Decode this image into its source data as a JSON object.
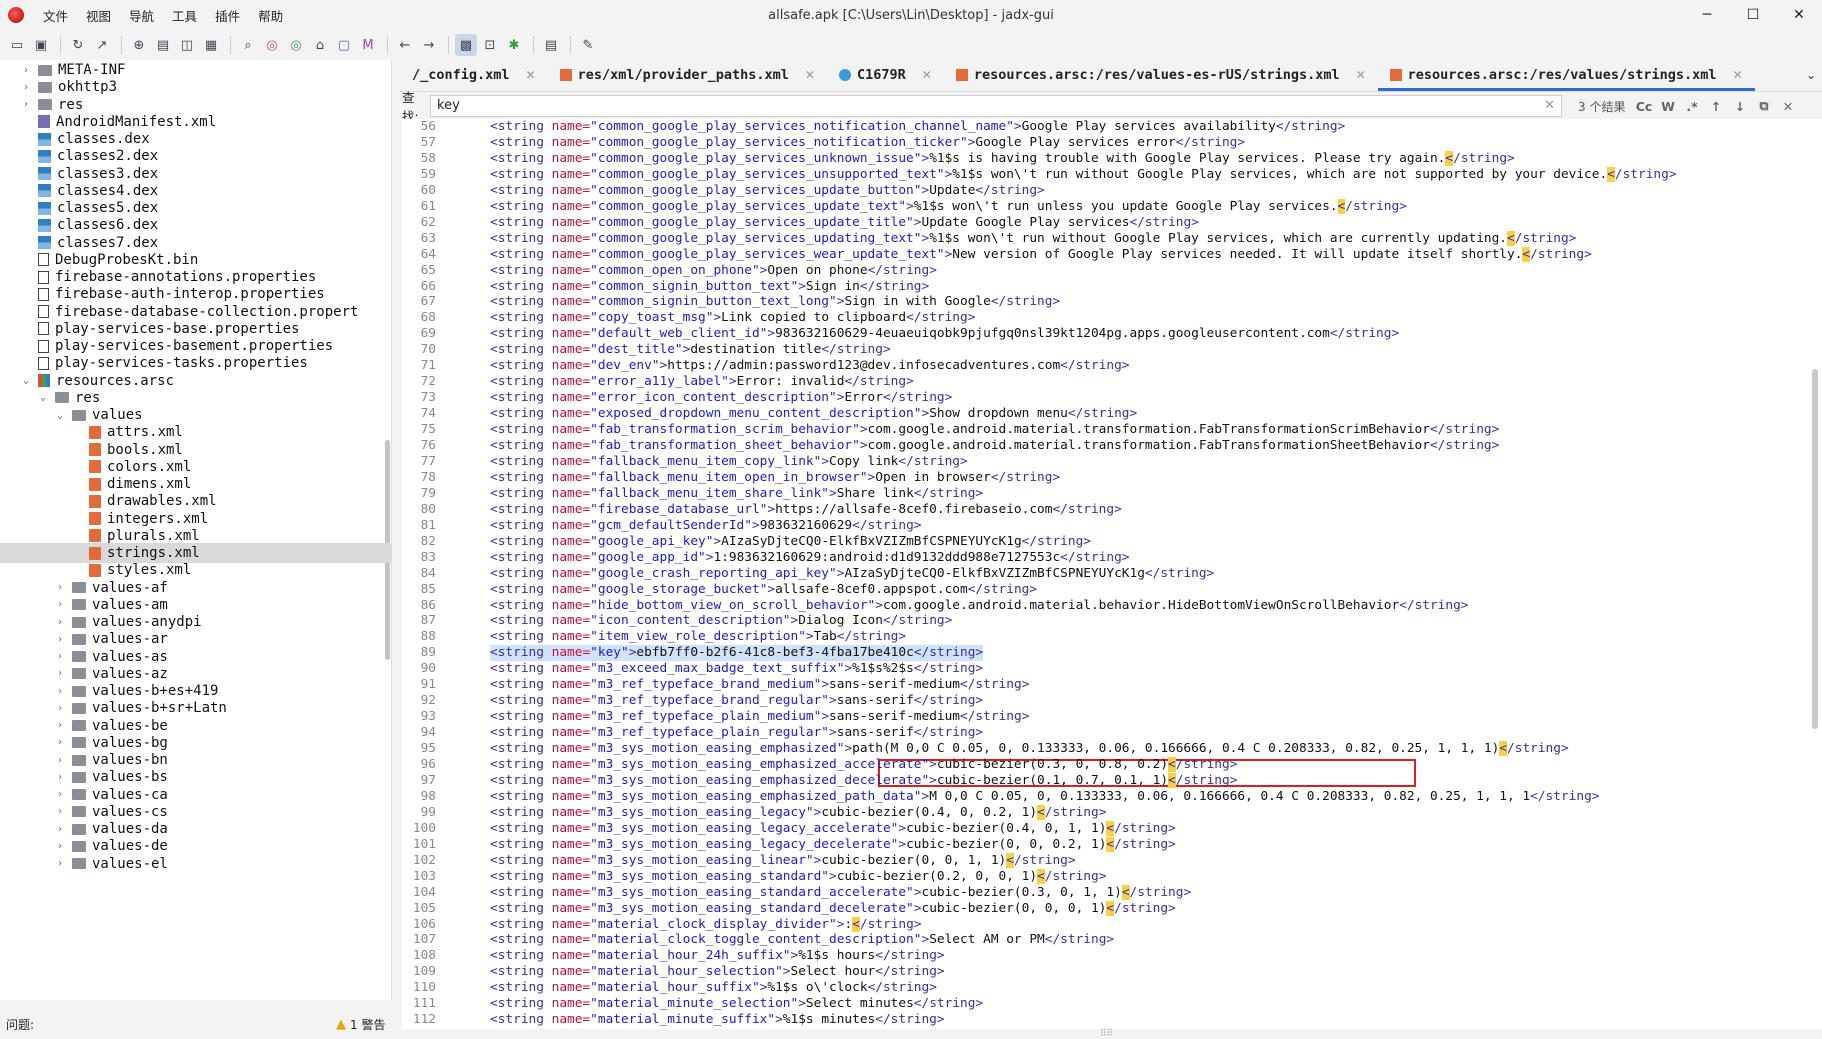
{
  "window": {
    "title": "allsafe.apk [C:\\Users\\Lin\\Desktop] - jadx-gui",
    "menus": [
      "文件",
      "视图",
      "导航",
      "工具",
      "插件",
      "帮助"
    ],
    "controls": [
      "─",
      "☐",
      "✕"
    ]
  },
  "toolbar": {
    "icons": [
      "open-icon",
      "save-all-icon",
      "reload-icon",
      "export-icon",
      "sync-icon",
      "flatten-icon",
      "deobf-icon",
      "table-icon",
      "search-icon",
      "search-class-icon",
      "search-usage-icon",
      "home-icon",
      "log-icon",
      "mode-icon",
      "back-icon",
      "forward-icon",
      "quark-icon",
      "preview-icon",
      "debug-icon",
      "log-viewer-icon",
      "settings-icon"
    ]
  },
  "tree": [
    {
      "label": "META-INF",
      "indent": 1,
      "chev": "›",
      "icon": "folder"
    },
    {
      "label": "okhttp3",
      "indent": 1,
      "chev": "›",
      "icon": "folder"
    },
    {
      "label": "res",
      "indent": 1,
      "chev": "›",
      "icon": "folder"
    },
    {
      "label": "AndroidManifest.xml",
      "indent": 1,
      "chev": "",
      "icon": "man"
    },
    {
      "label": "classes.dex",
      "indent": 1,
      "chev": "",
      "icon": "dex"
    },
    {
      "label": "classes2.dex",
      "indent": 1,
      "chev": "",
      "icon": "dex"
    },
    {
      "label": "classes3.dex",
      "indent": 1,
      "chev": "",
      "icon": "dex"
    },
    {
      "label": "classes4.dex",
      "indent": 1,
      "chev": "",
      "icon": "dex"
    },
    {
      "label": "classes5.dex",
      "indent": 1,
      "chev": "",
      "icon": "dex"
    },
    {
      "label": "classes6.dex",
      "indent": 1,
      "chev": "",
      "icon": "dex"
    },
    {
      "label": "classes7.dex",
      "indent": 1,
      "chev": "",
      "icon": "dex"
    },
    {
      "label": "DebugProbesKt.bin",
      "indent": 1,
      "chev": "",
      "icon": "file"
    },
    {
      "label": "firebase-annotations.properties",
      "indent": 1,
      "chev": "",
      "icon": "file"
    },
    {
      "label": "firebase-auth-interop.properties",
      "indent": 1,
      "chev": "",
      "icon": "file"
    },
    {
      "label": "firebase-database-collection.propert",
      "indent": 1,
      "chev": "",
      "icon": "file"
    },
    {
      "label": "play-services-base.properties",
      "indent": 1,
      "chev": "",
      "icon": "file"
    },
    {
      "label": "play-services-basement.properties",
      "indent": 1,
      "chev": "",
      "icon": "file"
    },
    {
      "label": "play-services-tasks.properties",
      "indent": 1,
      "chev": "",
      "icon": "file"
    },
    {
      "label": "resources.arsc",
      "indent": 1,
      "chev": "⌄",
      "icon": "arsc"
    },
    {
      "label": "res",
      "indent": 2,
      "chev": "⌄",
      "icon": "folder"
    },
    {
      "label": "values",
      "indent": 3,
      "chev": "⌄",
      "icon": "folder"
    },
    {
      "label": "attrs.xml",
      "indent": 4,
      "chev": "",
      "icon": "xml"
    },
    {
      "label": "bools.xml",
      "indent": 4,
      "chev": "",
      "icon": "xml"
    },
    {
      "label": "colors.xml",
      "indent": 4,
      "chev": "",
      "icon": "xml"
    },
    {
      "label": "dimens.xml",
      "indent": 4,
      "chev": "",
      "icon": "xml"
    },
    {
      "label": "drawables.xml",
      "indent": 4,
      "chev": "",
      "icon": "xml"
    },
    {
      "label": "integers.xml",
      "indent": 4,
      "chev": "",
      "icon": "xml"
    },
    {
      "label": "plurals.xml",
      "indent": 4,
      "chev": "",
      "icon": "xml"
    },
    {
      "label": "strings.xml",
      "indent": 4,
      "chev": "",
      "icon": "xml",
      "selected": true
    },
    {
      "label": "styles.xml",
      "indent": 4,
      "chev": "",
      "icon": "xml"
    },
    {
      "label": "values-af",
      "indent": 3,
      "chev": "›",
      "icon": "folder"
    },
    {
      "label": "values-am",
      "indent": 3,
      "chev": "›",
      "icon": "folder"
    },
    {
      "label": "values-anydpi",
      "indent": 3,
      "chev": "›",
      "icon": "folder"
    },
    {
      "label": "values-ar",
      "indent": 3,
      "chev": "›",
      "icon": "folder"
    },
    {
      "label": "values-as",
      "indent": 3,
      "chev": "›",
      "icon": "folder"
    },
    {
      "label": "values-az",
      "indent": 3,
      "chev": "›",
      "icon": "folder"
    },
    {
      "label": "values-b+es+419",
      "indent": 3,
      "chev": "›",
      "icon": "folder"
    },
    {
      "label": "values-b+sr+Latn",
      "indent": 3,
      "chev": "›",
      "icon": "folder"
    },
    {
      "label": "values-be",
      "indent": 3,
      "chev": "›",
      "icon": "folder"
    },
    {
      "label": "values-bg",
      "indent": 3,
      "chev": "›",
      "icon": "folder"
    },
    {
      "label": "values-bn",
      "indent": 3,
      "chev": "›",
      "icon": "folder"
    },
    {
      "label": "values-bs",
      "indent": 3,
      "chev": "›",
      "icon": "folder"
    },
    {
      "label": "values-ca",
      "indent": 3,
      "chev": "›",
      "icon": "folder"
    },
    {
      "label": "values-cs",
      "indent": 3,
      "chev": "›",
      "icon": "folder"
    },
    {
      "label": "values-da",
      "indent": 3,
      "chev": "›",
      "icon": "folder"
    },
    {
      "label": "values-de",
      "indent": 3,
      "chev": "›",
      "icon": "folder"
    },
    {
      "label": "values-el",
      "indent": 3,
      "chev": "›",
      "icon": "folder"
    }
  ],
  "status": {
    "label": "问题:",
    "warnings": "1 警告"
  },
  "tabs": [
    {
      "label": "/_config.xml",
      "icon": "xml-partial"
    },
    {
      "label": "res/xml/provider_paths.xml",
      "icon": "xml"
    },
    {
      "label": "C1679R",
      "icon": "class"
    },
    {
      "label": "resources.arsc:/res/values-es-rUS/strings.xml",
      "icon": "xml"
    },
    {
      "label": "resources.arsc:/res/values/strings.xml",
      "icon": "xml",
      "active": true
    }
  ],
  "find": {
    "label": "查找:",
    "value": "key",
    "count": "3 个结果",
    "options": [
      "Cc",
      "W",
      ".*",
      "↑",
      "↓",
      "⧉",
      "✕"
    ]
  },
  "code": [
    {
      "n": "56",
      "name": "common_google_play_services_notification_channel_name",
      "text": "Google Play services availability"
    },
    {
      "n": "57",
      "name": "common_google_play_services_notification_ticker",
      "text": "Google Play services error"
    },
    {
      "n": "58",
      "name": "common_google_play_services_unknown_issue",
      "text": "%1$s is having trouble with Google Play services. Please try again.",
      "hl": true
    },
    {
      "n": "59",
      "name": "common_google_play_services_unsupported_text",
      "text": "%1$s won\\'t run without Google Play services, which are not supported by your device.",
      "hl": true
    },
    {
      "n": "60",
      "name": "common_google_play_services_update_button",
      "text": "Update"
    },
    {
      "n": "61",
      "name": "common_google_play_services_update_text",
      "text": "%1$s won\\'t run unless you update Google Play services.",
      "hl": true
    },
    {
      "n": "62",
      "name": "common_google_play_services_update_title",
      "text": "Update Google Play services"
    },
    {
      "n": "63",
      "name": "common_google_play_services_updating_text",
      "text": "%1$s won\\'t run without Google Play services, which are currently updating.",
      "hl": true
    },
    {
      "n": "64",
      "name": "common_google_play_services_wear_update_text",
      "text": "New version of Google Play services needed. It will update itself shortly.",
      "hl": true
    },
    {
      "n": "65",
      "name": "common_open_on_phone",
      "text": "Open on phone"
    },
    {
      "n": "66",
      "name": "common_signin_button_text",
      "text": "Sign in"
    },
    {
      "n": "67",
      "name": "common_signin_button_text_long",
      "text": "Sign in with Google"
    },
    {
      "n": "68",
      "name": "copy_toast_msg",
      "text": "Link copied to clipboard"
    },
    {
      "n": "69",
      "name": "default_web_client_id",
      "text": "983632160629-4euaeuiqobk9pjufgq0nsl39kt1204pg.apps.googleusercontent.com"
    },
    {
      "n": "70",
      "name": "dest_title",
      "text": "destination title"
    },
    {
      "n": "71",
      "name": "dev_env",
      "text": "https://admin:password123@dev.infosecadventures.com"
    },
    {
      "n": "72",
      "name": "error_a11y_label",
      "text": "Error: invalid"
    },
    {
      "n": "73",
      "name": "error_icon_content_description",
      "text": "Error"
    },
    {
      "n": "74",
      "name": "exposed_dropdown_menu_content_description",
      "text": "Show dropdown menu"
    },
    {
      "n": "75",
      "name": "fab_transformation_scrim_behavior",
      "text": "com.google.android.material.transformation.FabTransformationScrimBehavior"
    },
    {
      "n": "76",
      "name": "fab_transformation_sheet_behavior",
      "text": "com.google.android.material.transformation.FabTransformationSheetBehavior"
    },
    {
      "n": "77",
      "name": "fallback_menu_item_copy_link",
      "text": "Copy link"
    },
    {
      "n": "78",
      "name": "fallback_menu_item_open_in_browser",
      "text": "Open in browser"
    },
    {
      "n": "79",
      "name": "fallback_menu_item_share_link",
      "text": "Share link"
    },
    {
      "n": "80",
      "name": "firebase_database_url",
      "text": "https://allsafe-8cef0.firebaseio.com"
    },
    {
      "n": "81",
      "name": "gcm_defaultSenderId",
      "text": "983632160629"
    },
    {
      "n": "82",
      "name": "google_api_key",
      "text": "AIzaSyDjteCQ0-ElkfBxVZIZmBfCSPNEYUYcK1g"
    },
    {
      "n": "83",
      "name": "google_app_id",
      "text": "1:983632160629:android:d1d9132ddd988e7127553c"
    },
    {
      "n": "84",
      "name": "google_crash_reporting_api_key",
      "text": "AIzaSyDjteCQ0-ElkfBxVZIZmBfCSPNEYUYcK1g"
    },
    {
      "n": "85",
      "name": "google_storage_bucket",
      "text": "allsafe-8cef0.appspot.com"
    },
    {
      "n": "86",
      "name": "hide_bottom_view_on_scroll_behavior",
      "text": "com.google.android.material.behavior.HideBottomViewOnScrollBehavior"
    },
    {
      "n": "87",
      "name": "icon_content_description",
      "text": "Dialog Icon"
    },
    {
      "n": "88",
      "name": "item_view_role_description",
      "text": "Tab"
    },
    {
      "n": "89",
      "name": "key",
      "text": "ebfb7ff0-b2f6-41c8-bef3-4fba17be410c",
      "selected": true
    },
    {
      "n": "90",
      "name": "m3_exceed_max_badge_text_suffix",
      "text": "%1$s%2$s"
    },
    {
      "n": "91",
      "name": "m3_ref_typeface_brand_medium",
      "text": "sans-serif-medium"
    },
    {
      "n": "92",
      "name": "m3_ref_typeface_brand_regular",
      "text": "sans-serif"
    },
    {
      "n": "93",
      "name": "m3_ref_typeface_plain_medium",
      "text": "sans-serif-medium"
    },
    {
      "n": "94",
      "name": "m3_ref_typeface_plain_regular",
      "text": "sans-serif"
    },
    {
      "n": "95",
      "name": "m3_sys_motion_easing_emphasized",
      "text": "path(M 0,0 C 0.05, 0, 0.133333, 0.06, 0.166666, 0.4 C 0.208333, 0.82, 0.25, 1, 1, 1)",
      "hl": true
    },
    {
      "n": "96",
      "name": "m3_sys_motion_easing_emphasized_accelerate",
      "text": "cubic-bezier(0.3, 0, 0.8, 0.2)",
      "hl": true
    },
    {
      "n": "97",
      "name": "m3_sys_motion_easing_emphasized_decelerate",
      "text": "cubic-bezier(0.1, 0.7, 0.1, 1)",
      "hl": true
    },
    {
      "n": "98",
      "name": "m3_sys_motion_easing_emphasized_path_data",
      "text": "M 0,0 C 0.05, 0, 0.133333, 0.06, 0.166666, 0.4 C 0.208333, 0.82, 0.25, 1, 1, 1"
    },
    {
      "n": "99",
      "name": "m3_sys_motion_easing_legacy",
      "text": "cubic-bezier(0.4, 0, 0.2, 1)",
      "hl": true
    },
    {
      "n": "100",
      "name": "m3_sys_motion_easing_legacy_accelerate",
      "text": "cubic-bezier(0.4, 0, 1, 1)",
      "hl": true
    },
    {
      "n": "101",
      "name": "m3_sys_motion_easing_legacy_decelerate",
      "text": "cubic-bezier(0, 0, 0.2, 1)",
      "hl": true
    },
    {
      "n": "102",
      "name": "m3_sys_motion_easing_linear",
      "text": "cubic-bezier(0, 0, 1, 1)",
      "hl": true
    },
    {
      "n": "103",
      "name": "m3_sys_motion_easing_standard",
      "text": "cubic-bezier(0.2, 0, 0, 1)",
      "hl": true
    },
    {
      "n": "104",
      "name": "m3_sys_motion_easing_standard_accelerate",
      "text": "cubic-bezier(0.3, 0, 1, 1)",
      "hl": true
    },
    {
      "n": "105",
      "name": "m3_sys_motion_easing_standard_decelerate",
      "text": "cubic-bezier(0, 0, 0, 1)",
      "hl": true
    },
    {
      "n": "106",
      "name": "material_clock_display_divider",
      "text": ":",
      "hl": true
    },
    {
      "n": "107",
      "name": "material_clock_toggle_content_description",
      "text": "Select AM or PM"
    },
    {
      "n": "108",
      "name": "material_hour_24h_suffix",
      "text": "%1$s hours"
    },
    {
      "n": "109",
      "name": "material_hour_selection",
      "text": "Select hour"
    },
    {
      "n": "110",
      "name": "material_hour_suffix",
      "text": "%1$s o\\'clock"
    },
    {
      "n": "111",
      "name": "material_minute_selection",
      "text": "Select minutes"
    },
    {
      "n": "112",
      "name": "material_minute_suffix",
      "text": "%1$s minutes"
    }
  ],
  "syntax": {
    "tag_open": "<string",
    "attr": "name=",
    "tag_close": "</string>"
  }
}
